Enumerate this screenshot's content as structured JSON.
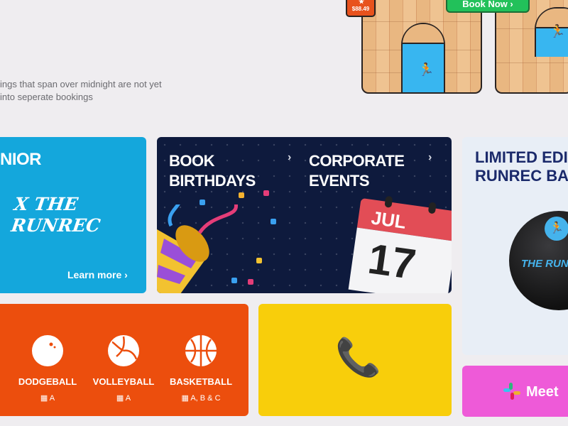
{
  "note": {
    "line1": "ings that span over midnight are not yet",
    "line2": "into seperate bookings"
  },
  "courts": {
    "price": "$88.49",
    "book_label": "Book Now",
    "book_chevron": "›"
  },
  "junior": {
    "title": "NIOR",
    "script1": "X THE",
    "script2": "RUNREC",
    "learn_more": "Learn more ›"
  },
  "events": {
    "birthdays1": "BOOK",
    "birthdays2": "BIRTHDAYS",
    "corporate1": "CORPORATE",
    "corporate2": "EVENTS",
    "month": "JUL",
    "day": "17",
    "chevron": "›"
  },
  "basketball_promo": {
    "title1": "LIMITED EDITI",
    "title2": "RUNREC BAS",
    "ball_brand": "THE RUN"
  },
  "sports": [
    {
      "name": "DODGEBALL",
      "courts": "A",
      "icon": "dodgeball-icon"
    },
    {
      "name": "VOLLEYBALL",
      "courts": "A",
      "icon": "volleyball-icon"
    },
    {
      "name": "BASKETBALL",
      "courts": "A, B & C",
      "icon": "basketball-icon"
    }
  ],
  "meet": {
    "label": "Meet"
  },
  "colors": {
    "junior": "#14a7dc",
    "events": "#0e1a3d",
    "sports": "#ec4e0d",
    "phone": "#f8ce0b",
    "meet": "#ee5ad8",
    "book": "#22c15a"
  }
}
